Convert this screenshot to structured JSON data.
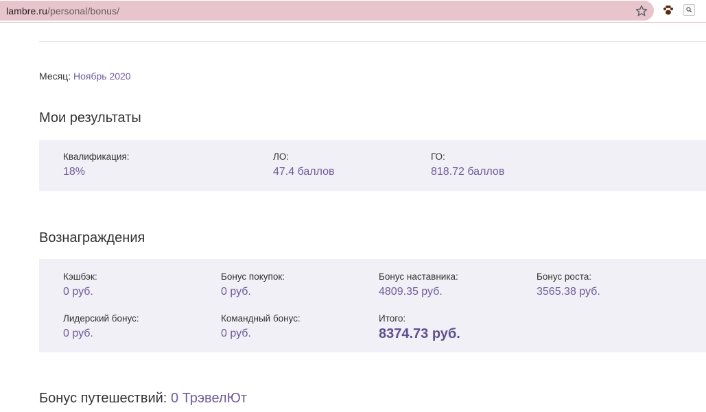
{
  "browser": {
    "url_host": "lambre.ru",
    "url_path": "/personal/bonus/"
  },
  "page": {
    "month_label": "Месяц: ",
    "month_value": "Ноябрь 2020",
    "results_heading": "Мои результаты",
    "results": [
      {
        "label": "Квалификация:",
        "value": "18%"
      },
      {
        "label": "ЛО:",
        "value": "47.4 баллов"
      },
      {
        "label": "ГО:",
        "value": "818.72 баллов"
      }
    ],
    "rewards_heading": "Вознаграждения",
    "rewards": [
      {
        "label": "Кэшбэк:",
        "value": "0 руб."
      },
      {
        "label": "Бонус покупок:",
        "value": "0 руб."
      },
      {
        "label": "Бонус наставника:",
        "value": "4809.35 руб."
      },
      {
        "label": "Бонус роста:",
        "value": "3565.38 руб."
      },
      {
        "label": "Лидерский бонус:",
        "value": "0 руб."
      },
      {
        "label": "Командный бонус:",
        "value": "0 руб."
      },
      {
        "label": "Итого:",
        "value": "8374.73 руб."
      }
    ],
    "travel_label": "Бонус путешествий: ",
    "travel_value": "0 ТрэвелЮт"
  },
  "colors": {
    "accent": "#6e5b9a",
    "panel_bg": "#f0f0f6",
    "omnibox_bg": "#e8c4cc"
  },
  "icons": [
    "star-icon",
    "paw-extension-icon",
    "search-extension-icon"
  ]
}
